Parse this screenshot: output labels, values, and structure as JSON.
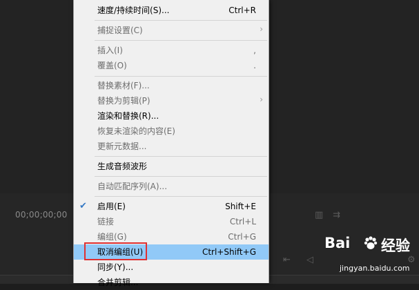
{
  "panel": {
    "timecode": "00;00;00;00"
  },
  "menu": {
    "items": [
      {
        "label": "速度/持续时间(S)...",
        "shortcut": "Ctrl+R",
        "enabled": true
      },
      {
        "label": "捕捉设置(C)",
        "shortcut": "",
        "enabled": false,
        "submenu": true
      },
      {
        "label": "插入(I)",
        "shortcut": ",",
        "enabled": false
      },
      {
        "label": "覆盖(O)",
        "shortcut": ".",
        "enabled": false
      },
      {
        "label": "替换素材(F)...",
        "shortcut": "",
        "enabled": false
      },
      {
        "label": "替换为剪辑(P)",
        "shortcut": "",
        "enabled": false,
        "submenu": true
      },
      {
        "label": "渲染和替换(R)...",
        "shortcut": "",
        "enabled": true
      },
      {
        "label": "恢复未渲染的内容(E)",
        "shortcut": "",
        "enabled": false
      },
      {
        "label": "更新元数据...",
        "shortcut": "",
        "enabled": false
      },
      {
        "label": "生成音频波形",
        "shortcut": "",
        "enabled": true
      },
      {
        "label": "自动匹配序列(A)...",
        "shortcut": "",
        "enabled": false
      },
      {
        "label": "启用(E)",
        "shortcut": "Shift+E",
        "enabled": true,
        "checked": true
      },
      {
        "label": "链接",
        "shortcut": "Ctrl+L",
        "enabled": false
      },
      {
        "label": "编组(G)",
        "shortcut": "Ctrl+G",
        "enabled": false
      },
      {
        "label": "取消编组(U)",
        "shortcut": "Ctrl+Shift+G",
        "enabled": true,
        "highlighted": true
      },
      {
        "label": "同步(Y)...",
        "shortcut": "",
        "enabled": true
      },
      {
        "label": "合并剪辑...",
        "shortcut": "",
        "enabled": true
      }
    ],
    "highlight_color": "#91c9f7",
    "annotation_color": "#e03030"
  },
  "watermark": {
    "logo": "Bai",
    "logo2": "经验",
    "url": "jingyan.baidu.com"
  }
}
